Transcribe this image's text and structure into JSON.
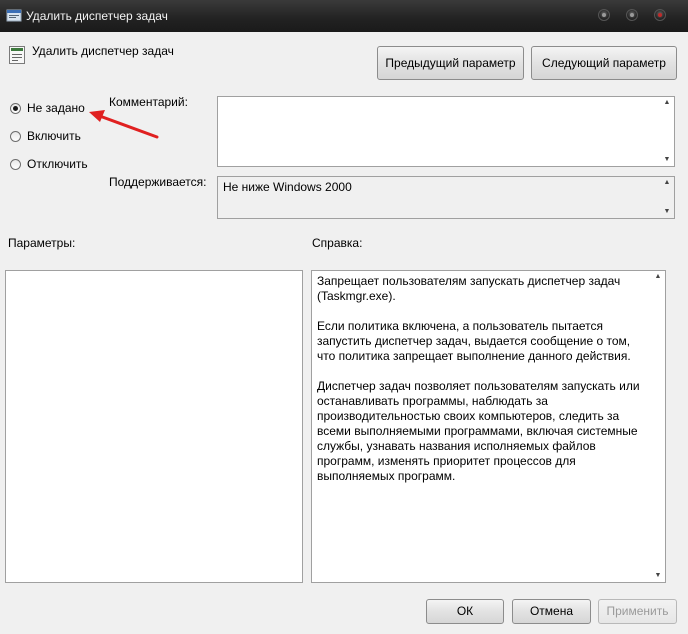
{
  "window": {
    "title": "Удалить диспетчер задач"
  },
  "header": {
    "policy_name": "Удалить диспетчер задач"
  },
  "nav": {
    "prev_label": "Предыдущий параметр",
    "next_label": "Следующий параметр"
  },
  "state": {
    "options": [
      {
        "label": "Не задано",
        "selected": true
      },
      {
        "label": "Включить",
        "selected": false
      },
      {
        "label": "Отключить",
        "selected": false
      }
    ]
  },
  "comment": {
    "label": "Комментарий:",
    "value": ""
  },
  "supported": {
    "label": "Поддерживается:",
    "value": "Не ниже Windows 2000"
  },
  "params": {
    "label": "Параметры:"
  },
  "help": {
    "label": "Справка:",
    "paragraphs": [
      "Запрещает пользователям запускать диспетчер задач (Taskmgr.exe).",
      "Если политика включена, а пользователь пытается запустить диспетчер задач, выдается сообщение о том, что политика запрещает выполнение данного действия.",
      "Диспетчер задач позволяет пользователям запускать или останавливать программы, наблюдать за производительностью своих компьютеров, следить за всеми выполняемыми программами, включая системные службы, узнавать названия исполняемых файлов программ, изменять приоритет процессов для выполняемых программ."
    ]
  },
  "footer": {
    "ok_label": "ОК",
    "cancel_label": "Отмена",
    "apply_label": "Применить"
  },
  "annotation": {
    "arrow_color": "#e02020"
  }
}
